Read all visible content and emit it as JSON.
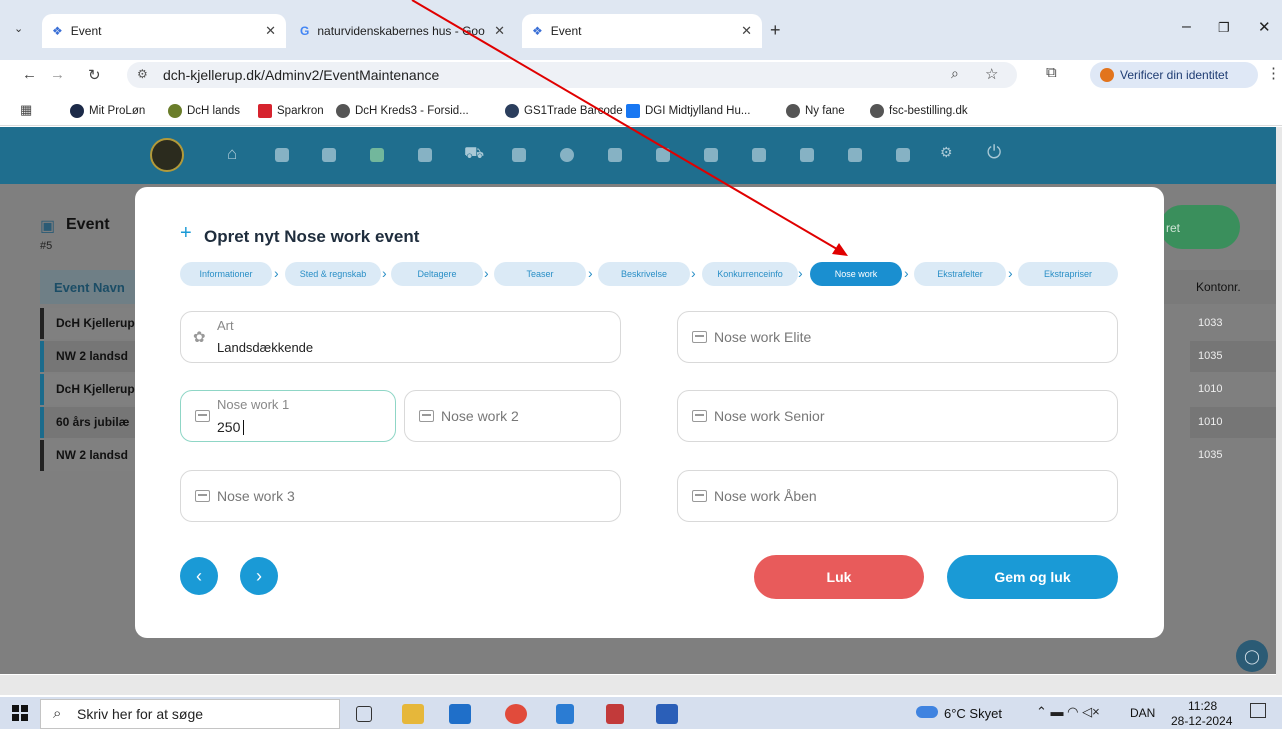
{
  "browser": {
    "tabs": [
      {
        "title": "Event"
      },
      {
        "title": "naturvidenskabernes hus - Goo"
      },
      {
        "title": "Event"
      }
    ],
    "address": "dch-kjellerup.dk/Adminv2/EventMaintenance",
    "verify_label": "Verificer din identitet",
    "bookmarks": [
      "Mit ProLøn",
      "DcH lands",
      "Sparkron",
      "DcH Kreds3 - Forsid...",
      "GS1Trade Barcode",
      "DGI Midtjylland Hu...",
      "Ny fane",
      "fsc-bestilling.dk"
    ]
  },
  "page": {
    "title": "Event",
    "count": "#5",
    "column_header": "Event Navn",
    "right_header": "Kontonr.",
    "add_button_partial": "ret",
    "rows": [
      {
        "name": "DcH Kjellerup",
        "kontonr": "1033"
      },
      {
        "name": "NW 2 landsd",
        "kontonr": "1035"
      },
      {
        "name": "DcH Kjellerup",
        "kontonr": "1010"
      },
      {
        "name": "60 års jubilæ",
        "kontonr": "1010"
      },
      {
        "name": "NW 2 landsd",
        "kontonr": "1035"
      }
    ]
  },
  "modal": {
    "title": "Opret nyt Nose work event",
    "steps": [
      "Informationer",
      "Sted & regnskab",
      "Deltagere",
      "Teaser",
      "Beskrivelse",
      "Konkurrenceinfo",
      "Nose work",
      "Ekstrafelter",
      "Ekstrapriser"
    ],
    "active_step": "Nose work",
    "fields": {
      "art": {
        "label": "Art",
        "value": "Landsdækkende"
      },
      "nw1": {
        "label": "Nose work 1",
        "value": "250"
      },
      "nw2": {
        "placeholder": "Nose work 2"
      },
      "nw3": {
        "placeholder": "Nose work 3"
      },
      "elite": {
        "placeholder": "Nose work Elite"
      },
      "senior": {
        "placeholder": "Nose work Senior"
      },
      "aaben": {
        "placeholder": "Nose work Åben"
      }
    },
    "close_label": "Luk",
    "save_label": "Gem og luk"
  },
  "taskbar": {
    "search_placeholder": "Skriv her for at søge",
    "weather": "6°C Skyet",
    "lang": "DAN",
    "time": "11:28",
    "date": "28-12-2024"
  },
  "colors": {
    "accent": "#1a9ad6",
    "danger": "#e85b5b",
    "nav": "#1f6e8e"
  }
}
